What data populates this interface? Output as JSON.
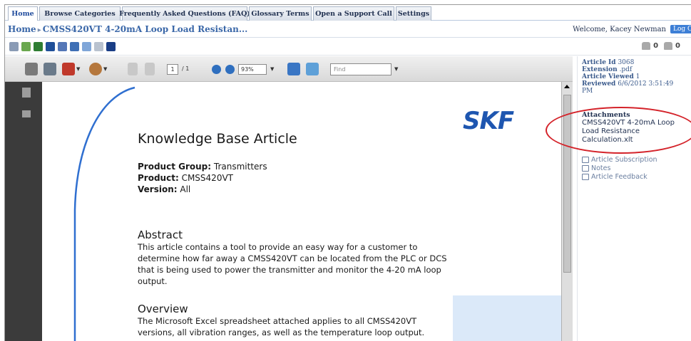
{
  "tabs": [
    {
      "label": "Home",
      "active": true
    },
    {
      "label": "Browse Categories",
      "active": false
    },
    {
      "label": "Frequently Asked Questions (FAQ)",
      "active": false
    },
    {
      "label": "Glossary Terms",
      "active": false
    },
    {
      "label": "Open a Support Call",
      "active": false
    },
    {
      "label": "Settings",
      "active": false
    }
  ],
  "breadcrumb": {
    "home": "Home",
    "separator": "▸",
    "current": "CMSS420VT 4-20mA Loop Load Resistan..."
  },
  "header": {
    "welcome": "Welcome, Kacey Newman",
    "logout": "Log Out"
  },
  "votes": {
    "up": "0",
    "down": "0"
  },
  "pdf_toolbar": {
    "page_current": "1",
    "page_total": "/ 1",
    "zoom": "93%",
    "find_placeholder": "Find"
  },
  "article": {
    "title": "Knowledge Base Article",
    "product_group_label": "Product Group:",
    "product_group": "Transmitters",
    "product_label": "Product:",
    "product": "CMSS420VT",
    "version_label": "Version:",
    "version": "All",
    "logo": "SKF",
    "abstract_heading": "Abstract",
    "abstract_text": "This article contains a tool to provide an easy way for a customer to determine how far away a CMSS420VT can be located from the PLC or DCS that is being used to power the transmitter and monitor the 4-20 mA loop output.",
    "overview_heading": "Overview",
    "overview_text": "The Microsoft Excel spreadsheet attached applies to all CMSS420VT versions, all vibration ranges, as well as the temperature loop output."
  },
  "sidebar": {
    "article_id_label": "Article Id",
    "article_id": "3068",
    "extension_label": "Extension",
    "extension": ".pdf",
    "viewed_label": "Article Viewed",
    "viewed": "1",
    "reviewed_label": "Reviewed",
    "reviewed": "6/6/2012 3:51:49",
    "reviewed_cont": "PM",
    "attachments_heading": "Attachments",
    "attachment_file": "CMSS420VT 4-20mA Loop Load Resistance Calculation.xlt",
    "links": [
      "Article Subscription",
      "Notes",
      "Article Feedback"
    ]
  },
  "colors": {
    "accent": "#3a67a8",
    "skf_blue": "#1e56b0",
    "highlight_red": "#d4232a"
  }
}
